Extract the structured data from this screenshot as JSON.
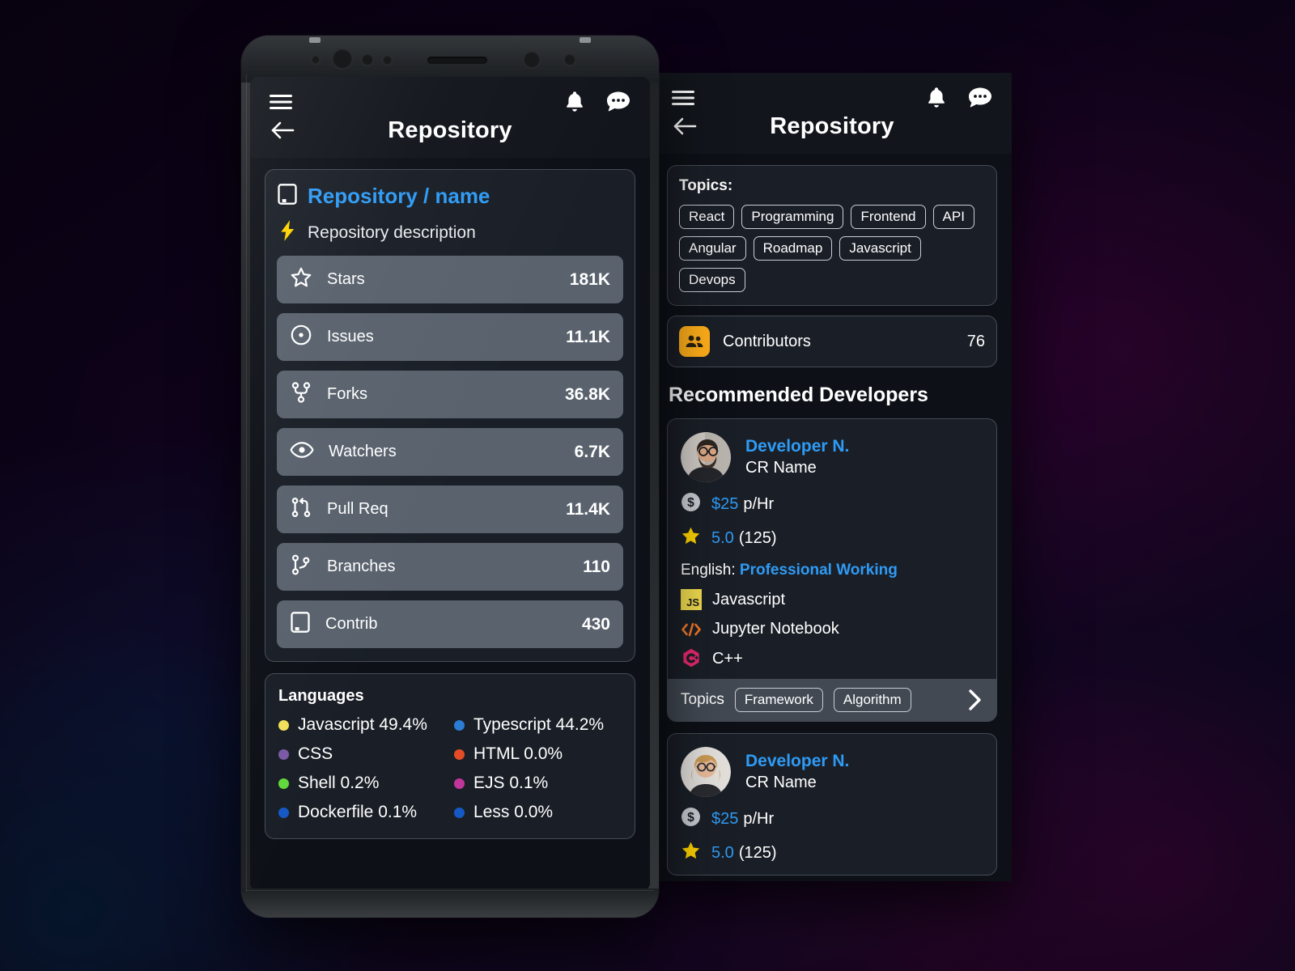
{
  "appbar": {
    "menu_icon": "hamburger-menu-icon",
    "bell_icon": "notification-bell-icon",
    "chat_icon": "chat-bubble-icon",
    "back_icon": "back-arrow-icon",
    "title": "Repository"
  },
  "repository": {
    "book_icon": "repo-book-icon",
    "name": "Repository / name",
    "bolt_icon": "lightning-bolt-icon",
    "description": "Repository description",
    "stats": [
      {
        "icon": "star-icon",
        "label": "Stars",
        "value": "181K"
      },
      {
        "icon": "issue-icon",
        "label": "Issues",
        "value": "11.1K"
      },
      {
        "icon": "fork-icon",
        "label": "Forks",
        "value": "36.8K"
      },
      {
        "icon": "eye-icon",
        "label": "Watchers",
        "value": "6.7K"
      },
      {
        "icon": "pull-req-icon",
        "label": "Pull Req",
        "value": "11.4K"
      },
      {
        "icon": "branch-icon",
        "label": "Branches",
        "value": "110"
      },
      {
        "icon": "repo-book-icon",
        "label": "Contrib",
        "value": "430"
      }
    ]
  },
  "languages": {
    "title": "Languages",
    "items": [
      {
        "name": "Javascript 49.4%",
        "color": "#f1e05a"
      },
      {
        "name": "Typescript 44.2%",
        "color": "#2b7cd3"
      },
      {
        "name": "CSS",
        "color": "#7b5aa6"
      },
      {
        "name": "HTML 0.0%",
        "color": "#e34c26"
      },
      {
        "name": "Shell 0.2%",
        "color": "#61d93b"
      },
      {
        "name": "EJS 0.1%",
        "color": "#c2369b"
      },
      {
        "name": "Dockerfile 0.1%",
        "color": "#1559c4"
      },
      {
        "name": "Less 0.0%",
        "color": "#1559c4"
      }
    ]
  },
  "topics": {
    "label": "Topics:",
    "chips": [
      "React",
      "Programming",
      "Frontend",
      "API",
      "Angular",
      "Roadmap",
      "Javascript",
      "Devops"
    ]
  },
  "contributors": {
    "icon": "people-group-icon",
    "label": "Contributors",
    "value": "76",
    "icon_color": "#FFAE1A"
  },
  "recommended": {
    "heading": "Recommended Developers",
    "cards": [
      {
        "avatar": "developer-avatar-male",
        "name": "Developer N.",
        "subtitle": "CR Name",
        "rate_icon": "dollar-coin-icon",
        "rate_value": "$25",
        "rate_unit": "p/Hr",
        "star_icon": "star-filled-icon",
        "rating": "5.0",
        "rating_count": "(125)",
        "english_label": "English:",
        "english_level": "Professional Working",
        "skills": [
          {
            "icon": "js-badge-icon",
            "name": "Javascript"
          },
          {
            "icon": "code-brackets-icon",
            "name": "Jupyter Notebook"
          },
          {
            "icon": "cpp-hexagon-icon",
            "name": "C++"
          }
        ],
        "footer_label": "Topics",
        "footer_chips": [
          "Framework",
          "Algorithm"
        ],
        "footer_arrow_icon": "chevron-right-icon"
      },
      {
        "avatar": "developer-avatar-female",
        "name": "Developer N.",
        "subtitle": "CR Name",
        "rate_icon": "dollar-coin-icon",
        "rate_value": "$25",
        "rate_unit": "p/Hr",
        "star_icon": "star-filled-icon",
        "rating": "5.0",
        "rating_count": "(125)"
      }
    ]
  },
  "colors": {
    "accent_blue": "#2f9bf5",
    "card_bg": "#1a1f27",
    "stat_row_bg": "#59626d",
    "appbar_bg": "#12161c",
    "screen_bg": "#0d1117",
    "amber": "#FFAE1A",
    "star_yellow": "#FFD400"
  }
}
